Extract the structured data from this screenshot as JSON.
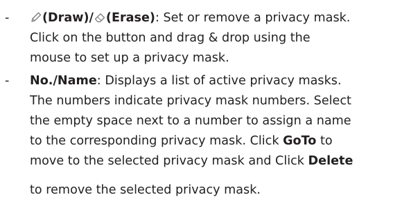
{
  "bullet_dash": "-",
  "item1": {
    "draw_label": "(Draw)/",
    "erase_label": "(Erase)",
    "sep": ": ",
    "line1_rest": "Set or remove a privacy mask.",
    "line2": "Click on the button and drag & drop using the",
    "line3": "mouse to set up a privacy mask.",
    "draw_icon": "pencil-icon",
    "erase_icon": "eraser-icon"
  },
  "item2": {
    "term": "No./Name",
    "line1_rest": ": Displays a list of active privacy masks.",
    "line2": "The numbers indicate privacy mask numbers. Select",
    "line3": "the empty space next to a number to assign a name",
    "line4_pre": "to the corresponding privacy mask. Click ",
    "goto": "GoTo",
    "line4_post": " to",
    "line5_pre": "move to the selected privacy mask and Click ",
    "delete": "Delete",
    "line6": "to remove the selected privacy mask."
  }
}
